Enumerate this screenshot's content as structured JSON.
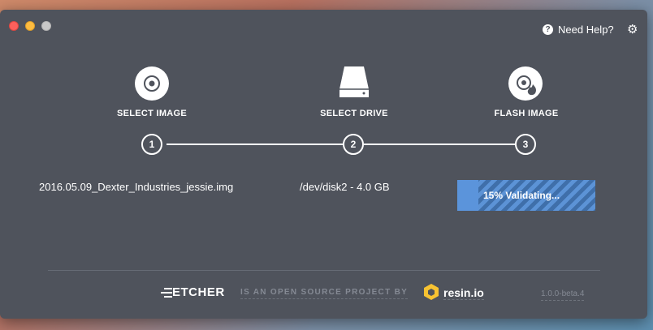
{
  "window": {
    "help_label": "Need Help?",
    "help_icon": "question-circle-icon",
    "settings_icon": "gear-icon"
  },
  "steps": [
    {
      "label": "SELECT IMAGE",
      "number": "1",
      "icon": "disc-icon"
    },
    {
      "label": "SELECT DRIVE",
      "number": "2",
      "icon": "drive-icon"
    },
    {
      "label": "FLASH IMAGE",
      "number": "3",
      "icon": "flash-disc-icon"
    }
  ],
  "selection": {
    "image": "2016.05.09_Dexter_Industries_jessie.img",
    "drive": "/dev/disk2 - 4.0 GB"
  },
  "progress": {
    "percent": 15,
    "label": "15% Validating..."
  },
  "footer": {
    "brand": "ETCHER",
    "tagline": "IS AN OPEN SOURCE PROJECT BY",
    "company": "resin.io",
    "version": "1.0.0-beta.4"
  },
  "colors": {
    "window_bg": "#4f535c",
    "progress_accent": "#5b94db",
    "muted_text": "#858a94"
  }
}
